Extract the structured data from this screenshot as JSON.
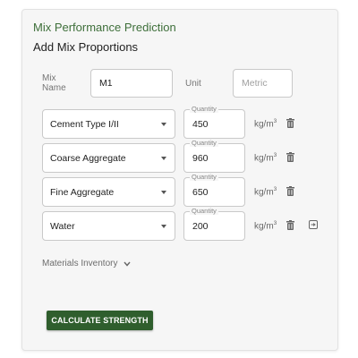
{
  "header": {
    "title": "Mix Performance Prediction",
    "subtitle": "Add Mix Proportions"
  },
  "mix": {
    "name_label": "Mix Name",
    "name_value": "M1",
    "unit_label": "Unit",
    "unit_placeholder": "Metric"
  },
  "materials": [
    {
      "material": "Cement Type I/II",
      "quantity_label": "Quantity",
      "quantity": "450",
      "unit_base": "kg/m",
      "unit_exp": "3"
    },
    {
      "material": "Coarse Aggregate",
      "quantity_label": "Quantity",
      "quantity": "960",
      "unit_base": "kg/m",
      "unit_exp": "3"
    },
    {
      "material": "Fine Aggregate",
      "quantity_label": "Quantity",
      "quantity": "650",
      "unit_base": "kg/m",
      "unit_exp": "3"
    },
    {
      "material": "Water",
      "quantity_label": "Quantity",
      "quantity": "200",
      "unit_base": "kg/m",
      "unit_exp": "3"
    }
  ],
  "inventory": {
    "label": "Materials Inventory"
  },
  "actions": {
    "calculate_label": "CALCULATE STRENGTH"
  },
  "colors": {
    "accent": "#3e6f3a",
    "button": "#2f5e2d"
  },
  "icons": {
    "delete": "trash-icon",
    "add": "add-row-icon",
    "dropdown": "caret-down-icon",
    "expand": "chevron-down-icon"
  }
}
